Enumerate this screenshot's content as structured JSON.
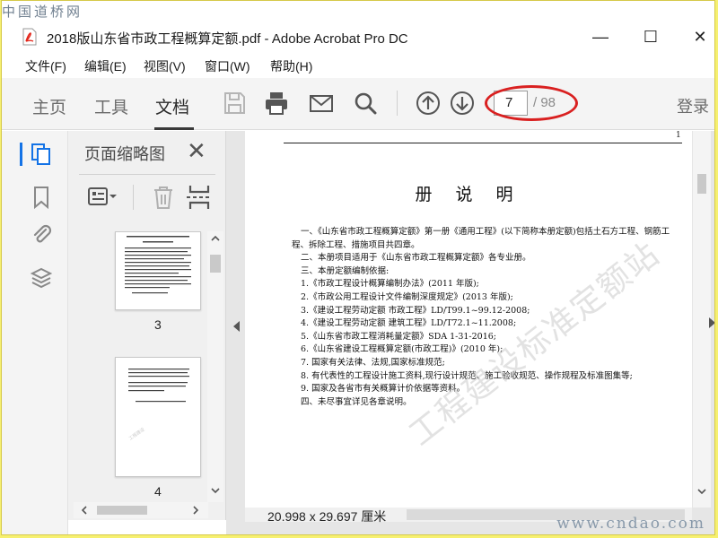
{
  "watermarks": {
    "top_left": "中国道桥网",
    "bottom_right": "www.cndao.com",
    "diagonal": "工程建设标准定额站"
  },
  "window": {
    "title": "2018版山东省市政工程概算定额.pdf - Adobe Acrobat Pro DC",
    "minimize": "—",
    "maximize": "☐",
    "close": "✕"
  },
  "menu": {
    "items": [
      "文件(F)",
      "编辑(E)",
      "视图(V)",
      "窗口(W)",
      "帮助(H)"
    ]
  },
  "toolbar": {
    "tabs": [
      "主页",
      "工具",
      "文档"
    ],
    "active_tab": "文档",
    "current_page": "7",
    "total_pages": "/ 98",
    "login": "登录"
  },
  "thumbnails_panel": {
    "title": "页面缩略图",
    "close": "✕",
    "thumbs": [
      {
        "label": "3"
      },
      {
        "label": "4"
      }
    ]
  },
  "document": {
    "page_number": "1",
    "heading": "册 说 明",
    "paragraphs": [
      "一、《山东省市政工程概算定额》第一册《通用工程》(以下简称本册定额)包括土石方工程、钢筋工程、拆除工程、措施项目共四章。",
      "二、本册项目适用于《山东省市政工程概算定额》各专业册。",
      "三、本册定额编制依据:",
      "1.《市政工程设计概算编制办法》(2011 年版);",
      "2.《市政公用工程设计文件编制深度规定》(2013 年版);",
      "3.《建设工程劳动定额 市政工程》LD/T99.1~99.12-2008;",
      "4.《建设工程劳动定额 建筑工程》LD/T72.1~11.2008;",
      "5.《山东省市政工程消耗量定额》SDA 1-31-2016;",
      "6.《山东省建设工程概算定额(市政工程)》(2010 年);",
      "7. 国家有关法律、法规,国家标准规范;",
      "8. 有代表性的工程设计施工资料,现行设计规范、施工验收规范、操作规程及标准图集等;",
      "9. 国家及各省市有关概算计价依据等资料。",
      "四、未尽事宜详见各章说明。"
    ],
    "page_size": "20.998 x 29.697 厘米"
  },
  "colors": {
    "accent": "#1473e6",
    "annotation": "#d92020",
    "background_border": "#f6f070"
  }
}
